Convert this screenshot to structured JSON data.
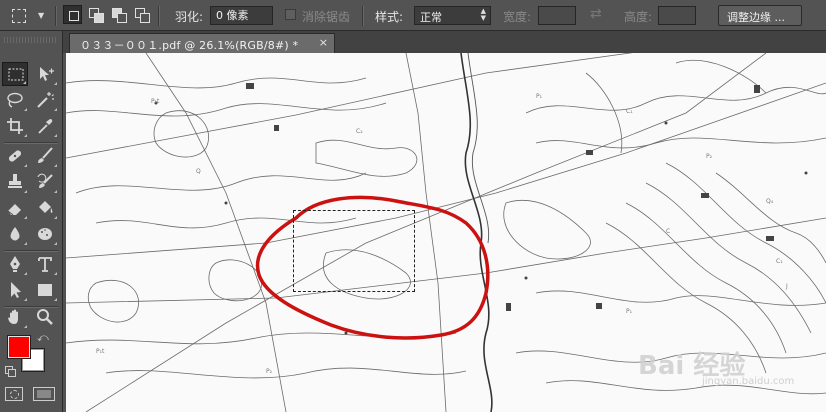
{
  "options_bar": {
    "feather_label": "羽化:",
    "feather_value": "0 像素",
    "antialias_label": "消除锯齿",
    "style_label": "样式:",
    "style_value": "正常",
    "width_label": "宽度:",
    "width_value": "",
    "height_label": "高度:",
    "height_value": "",
    "refine_edge_label": "调整边缘 ..."
  },
  "document": {
    "tab_title": "０３３－００１.pdf @ 26.1%(RGB/8#) *",
    "close_glyph": "×"
  },
  "canvas": {
    "watermark_text": "Bai 经验",
    "watermark_sub": "jingyan.baidu.com"
  },
  "colors": {
    "foreground": "#ff0000",
    "background": "#ffffff",
    "annotation_stroke": "#cc1111"
  },
  "toolbox": {
    "active_tool": "rectangular-marquee",
    "tools": [
      "rectangular-marquee",
      "move",
      "lasso",
      "magic-wand",
      "crop",
      "eyedropper",
      "spot-healing",
      "brush",
      "clone-stamp",
      "history-brush",
      "eraser",
      "paint-bucket",
      "blur",
      "dodge",
      "pen",
      "type",
      "path-selection",
      "rectangle",
      "hand",
      "zoom"
    ]
  }
}
